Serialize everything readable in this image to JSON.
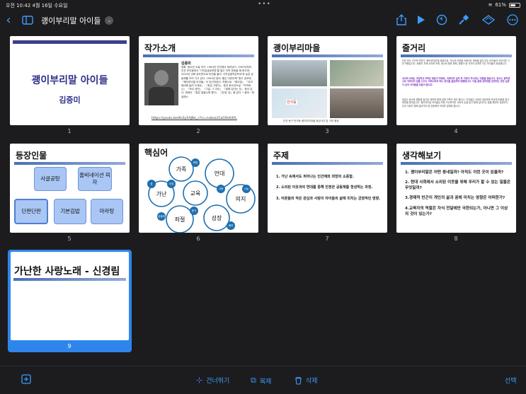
{
  "status": {
    "time": "오전 10:42",
    "date": "4월 16일 수요일",
    "dots": "•••",
    "battery": "61%",
    "battery_level": 0.61
  },
  "toolbar": {
    "back": "‹",
    "title": "괭이부리말 아이들",
    "title_chevron": "⌄",
    "icons": [
      "back-icon",
      "sidebar-icon",
      "share-icon",
      "play-icon",
      "undo-icon",
      "format-brush-icon",
      "diamond-icon",
      "more-icon"
    ]
  },
  "slides": [
    {
      "num": "1",
      "title": "괭이부리말 아이들",
      "author": "김중미"
    },
    {
      "num": "2",
      "title": "작가소개",
      "name": "김중미",
      "bio": "동화, 청소년 소설 작가. 1963년 인천에서 태어났다. 1987년부터 인천 만석동에서 '기찻길옆공부방'을 열고 지역 운동을 해 왔으며, 2001년 강화 양도면으로 터전을 옮겨 '기찻길옆작은학교'와 농촌 공동체를 꾸려 가고 있다. 1999년 창비 '좋은 어린이책' 원고 공모에 『괭이부리말 아이들』이 당선되었다. 작품으로 『종이밥』 『우리 동네에 놀러 오세요』 『꽃섬 고양이』 등과 청소년소설 『조커와 나』 『모두 깜언』 『그날, 그 아이』 『곁에 있다는 것』 등이 있다. 에세이 『꽃은 많을수록 좋다』 『존재, 감』을 냈다. * 출처 : 채널예스",
      "link": "https://youtu.be/KsSy5AJBo_c?si=nxboa31oG9cK4YL"
    },
    {
      "num": "3",
      "title": "괭이부리마을",
      "caption": "인천 동구 만석동 괭이부리마을 위성사진 및 거리 풍경",
      "map_label": "만석동"
    },
    {
      "num": "4",
      "title": "줄거리",
      "p1": "인천 부두 근처의 빈민가 '괭이부리말'을 배경으로, 가난과 어려움 속에서도 희망을 잃지 않는 아이들의 이야기를 그린 작품입니다. 쌍둥이 자매 숙자와 숙희, 동수와 동준 형제, 명환이 등 각자의 상처를 지닌 아이들이 등장합니다.",
      "p2": "숙자와 숙희는 초등학교 5학년 쌍둥이 자매로, 아버지의 실직 후 가정이 무너지는 아픔을 겪습니다. 동수는 중학생으로 아버지가 집을 나가고 어머니마저 떠나 본드를 흡입하며 방황합니다. 이들 곁에 공부방을 운영하는 영호 삼촌이 있어 아이들을 보듬어 줍니다.",
      "p3": "영호는 동수와 명환을 집으로 데려와 함께 살며 가족이 되어 줍니다. 아이들은 서로를 위로하며 조금씩 마음을 열고 희망을 찾아갑니다. 괭이부리말 아이들은 비록 가난하지만 서로의 손을 잡고 함께 살아가는 법을 배우며 성장하고, 우리 사회가 함께 살아가야 할 공동체의 의미를 일깨워 줍니다."
    },
    {
      "num": "5",
      "title": "등장인물",
      "characters": [
        "사글공탕",
        "홈비네이션 피자",
        "단짠단짠",
        "기본김밥",
        "마라탕"
      ]
    },
    {
      "num": "6",
      "title": "핵심어",
      "words": [
        "가족",
        "언대",
        "가난",
        "교육",
        "의지",
        "좌절",
        "성장"
      ],
      "small": [
        "희망",
        "꿈",
        "우정",
        "사랑",
        "나눔",
        "공동체",
        "용기",
        "배려"
      ]
    },
    {
      "num": "7",
      "title": "주제",
      "items": [
        "1.  가난 속에서도 피어나는 인간애와 희망의 소중함.",
        "2.  소외된 이웃과의 연대를 통해 진정한 공동체를 형성하는 과정.",
        "3.  어른들의 작은 관심과 사랑이 아이들의 삶에 미치는 긍정적인 영향."
      ]
    },
    {
      "num": "8",
      "title": "생각해보기",
      "items": [
        "1. 괭이부리말은 어떤 동네일까? 아직도 이런 곳이 있을까?",
        "2. 현대 사회에서 소외된 이웃을 위해 우리가 할 수 있는 일들은 무엇일까?",
        "3.경제적 빈곤이 개인의 삶과 꿈에 미치는 영향은 어떠한가?",
        "4.교육자의 역할은 자식 전달에만 국한되는가, 아니면 그 이상의 것이 있는가?"
      ]
    },
    {
      "num": "9",
      "title": "가난한 사랑노래 - 신경림"
    }
  ],
  "bottom": {
    "add": "+",
    "skip": "건너뛰기",
    "copy": "복제",
    "delete": "삭제",
    "select": "선택"
  },
  "colors": {
    "accent": "#3c9cff",
    "selection": "#2e86ec",
    "title_navy": "#2e2f8a",
    "box_fill": "#a9c6f5",
    "circle_fill": "#1f6fae"
  }
}
